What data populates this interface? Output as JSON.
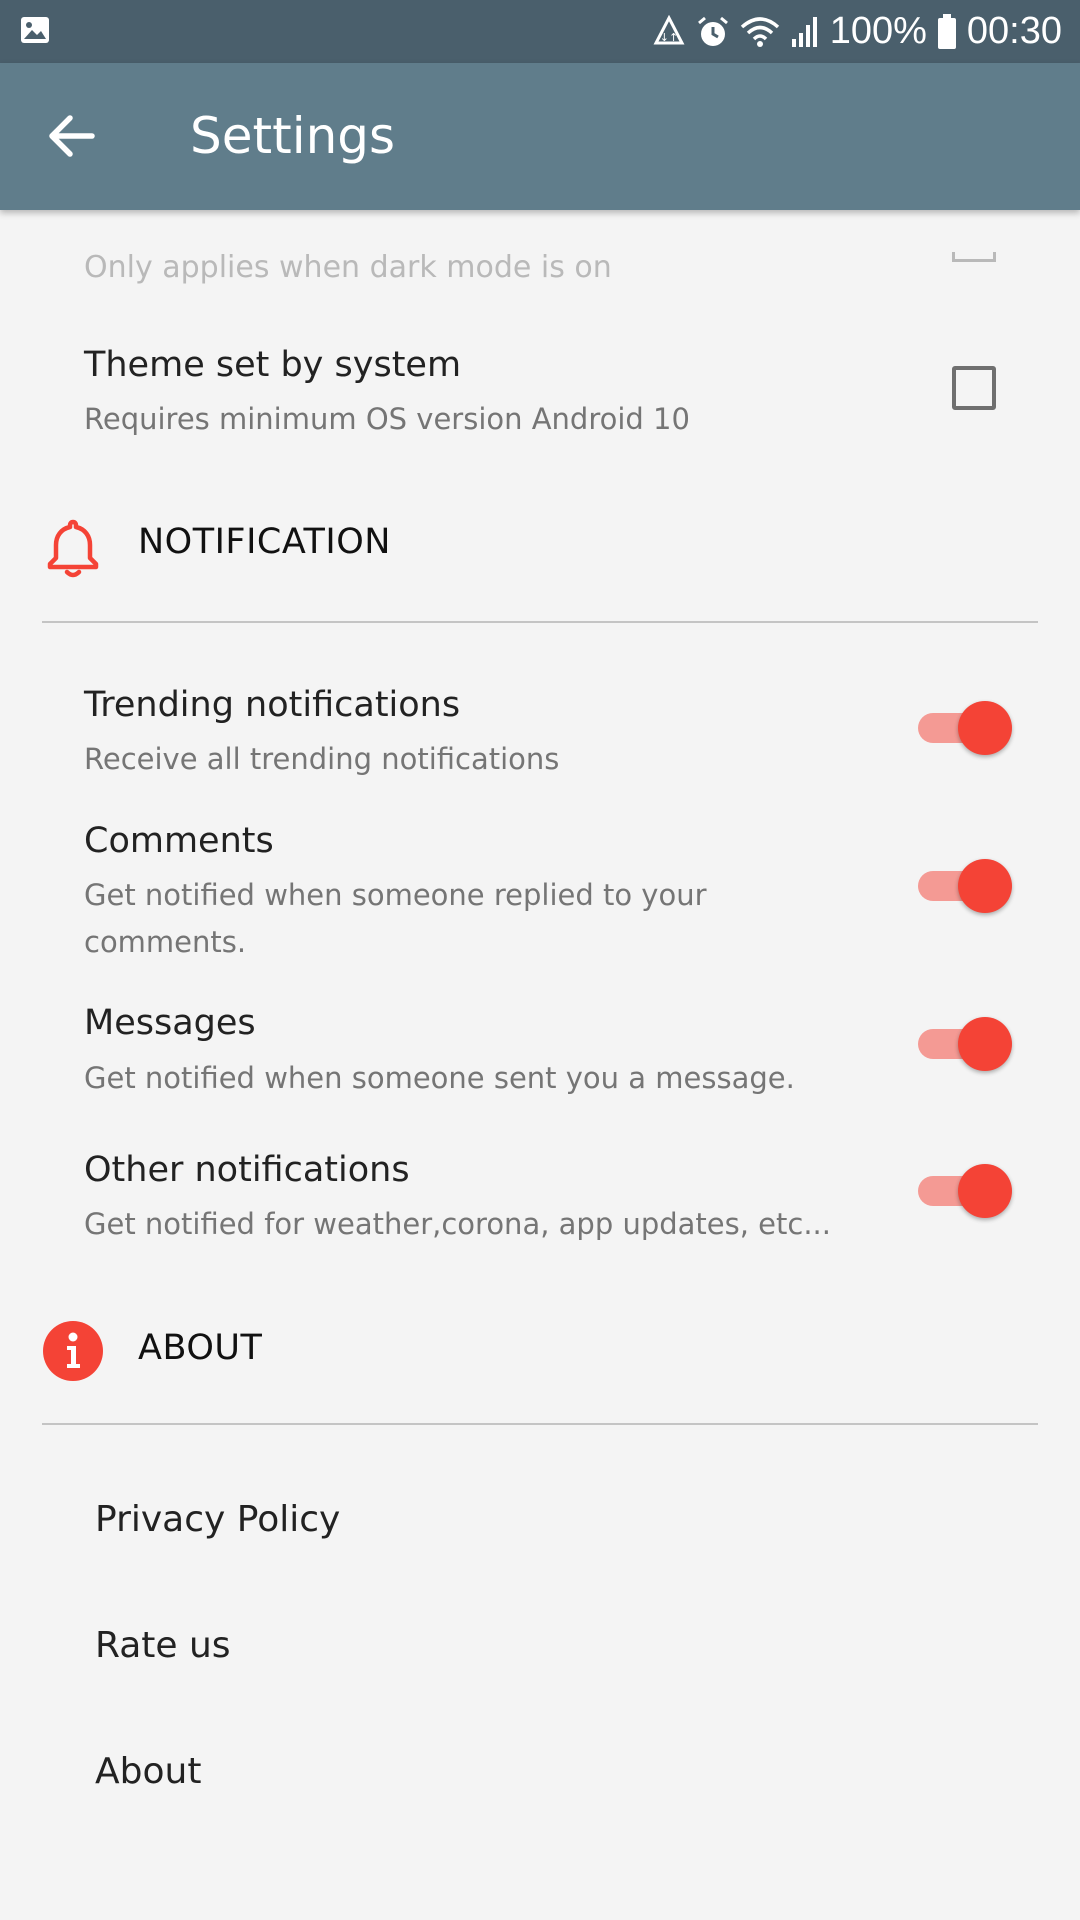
{
  "status_bar": {
    "battery_percent": "100%",
    "time": "00:30",
    "icons": [
      "image-icon",
      "data-saver-icon",
      "alarm-icon",
      "wifi-icon",
      "signal-icon",
      "battery-icon"
    ]
  },
  "app_bar": {
    "title": "Settings",
    "back_icon": "arrow-back-icon",
    "background": "#607d8b"
  },
  "theme": {
    "partial_item_subtitle": "Only applies when dark mode is on",
    "system_theme": {
      "title": "Theme set by system",
      "subtitle": "Requires minimum OS version Android 10",
      "checked": false
    }
  },
  "notification": {
    "header": "NOTIFICATION",
    "icon": "bell-icon",
    "items": [
      {
        "title": "Trending notifications",
        "subtitle": "Receive all trending notifications",
        "enabled": true
      },
      {
        "title": "Comments",
        "subtitle": "Get notified when someone replied to your comments.",
        "enabled": true
      },
      {
        "title": "Messages",
        "subtitle": "Get notified when someone sent you a message.",
        "enabled": true
      },
      {
        "title": "Other notifications",
        "subtitle": "Get notified for weather,corona, app updates, etc...",
        "enabled": true
      }
    ]
  },
  "about": {
    "header": "ABOUT",
    "icon": "info-icon",
    "items": [
      "Privacy Policy",
      "Rate us",
      "About"
    ]
  },
  "colors": {
    "accent": "#f44336",
    "accent_light": "#f49a94",
    "status_bar": "#4a5f6c"
  }
}
